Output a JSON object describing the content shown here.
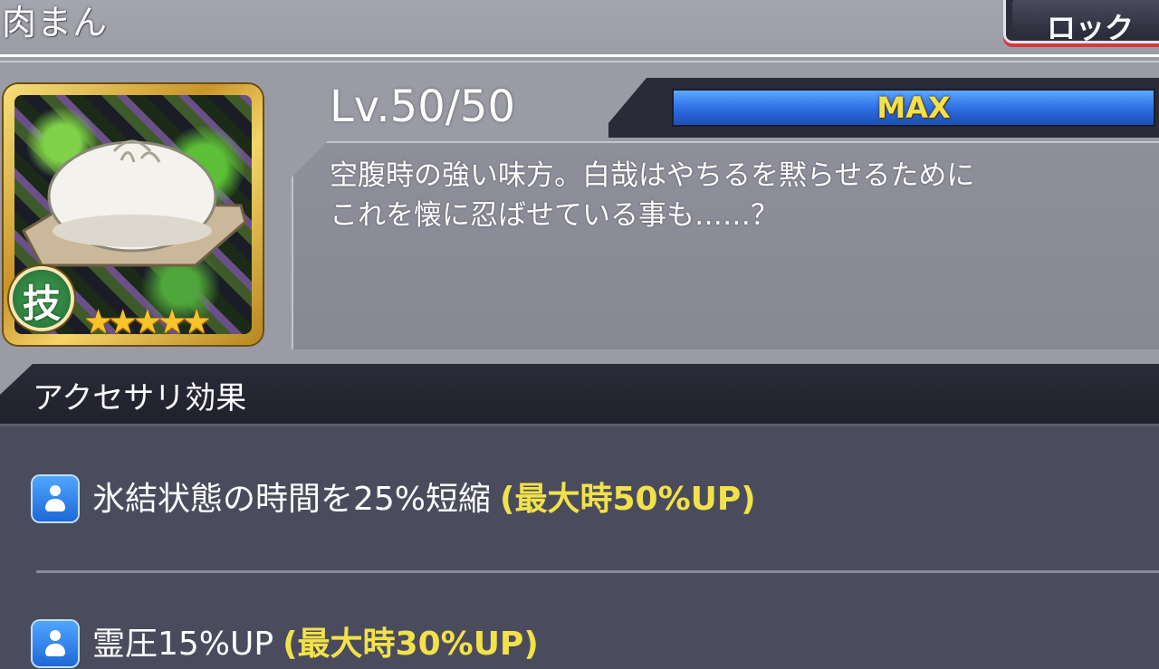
{
  "header": {
    "title": "肉まん",
    "lock_label": "ロック"
  },
  "item": {
    "type_badge": "技",
    "stars": "★★★★★",
    "level": "Lv.50/50",
    "level_bar_label": "MAX",
    "level_progress": 1.0,
    "description": "空腹時の強い味方。白哉はやちるを黙らせるために\nこれを懐に忍ばせている事も……？"
  },
  "effects": {
    "title": "アクセサリ効果",
    "items": [
      {
        "text": "氷結状態の時間を25%短縮",
        "max": "(最大時50%UP)",
        "icon": "user-icon"
      },
      {
        "text": "霊圧15%UP",
        "max": "(最大時30%UP)",
        "icon": "user-icon"
      }
    ]
  },
  "colors": {
    "accent_yellow": "#f2e24a",
    "bar_blue": "#2f6fe6",
    "lock_red": "#d63a3a"
  }
}
